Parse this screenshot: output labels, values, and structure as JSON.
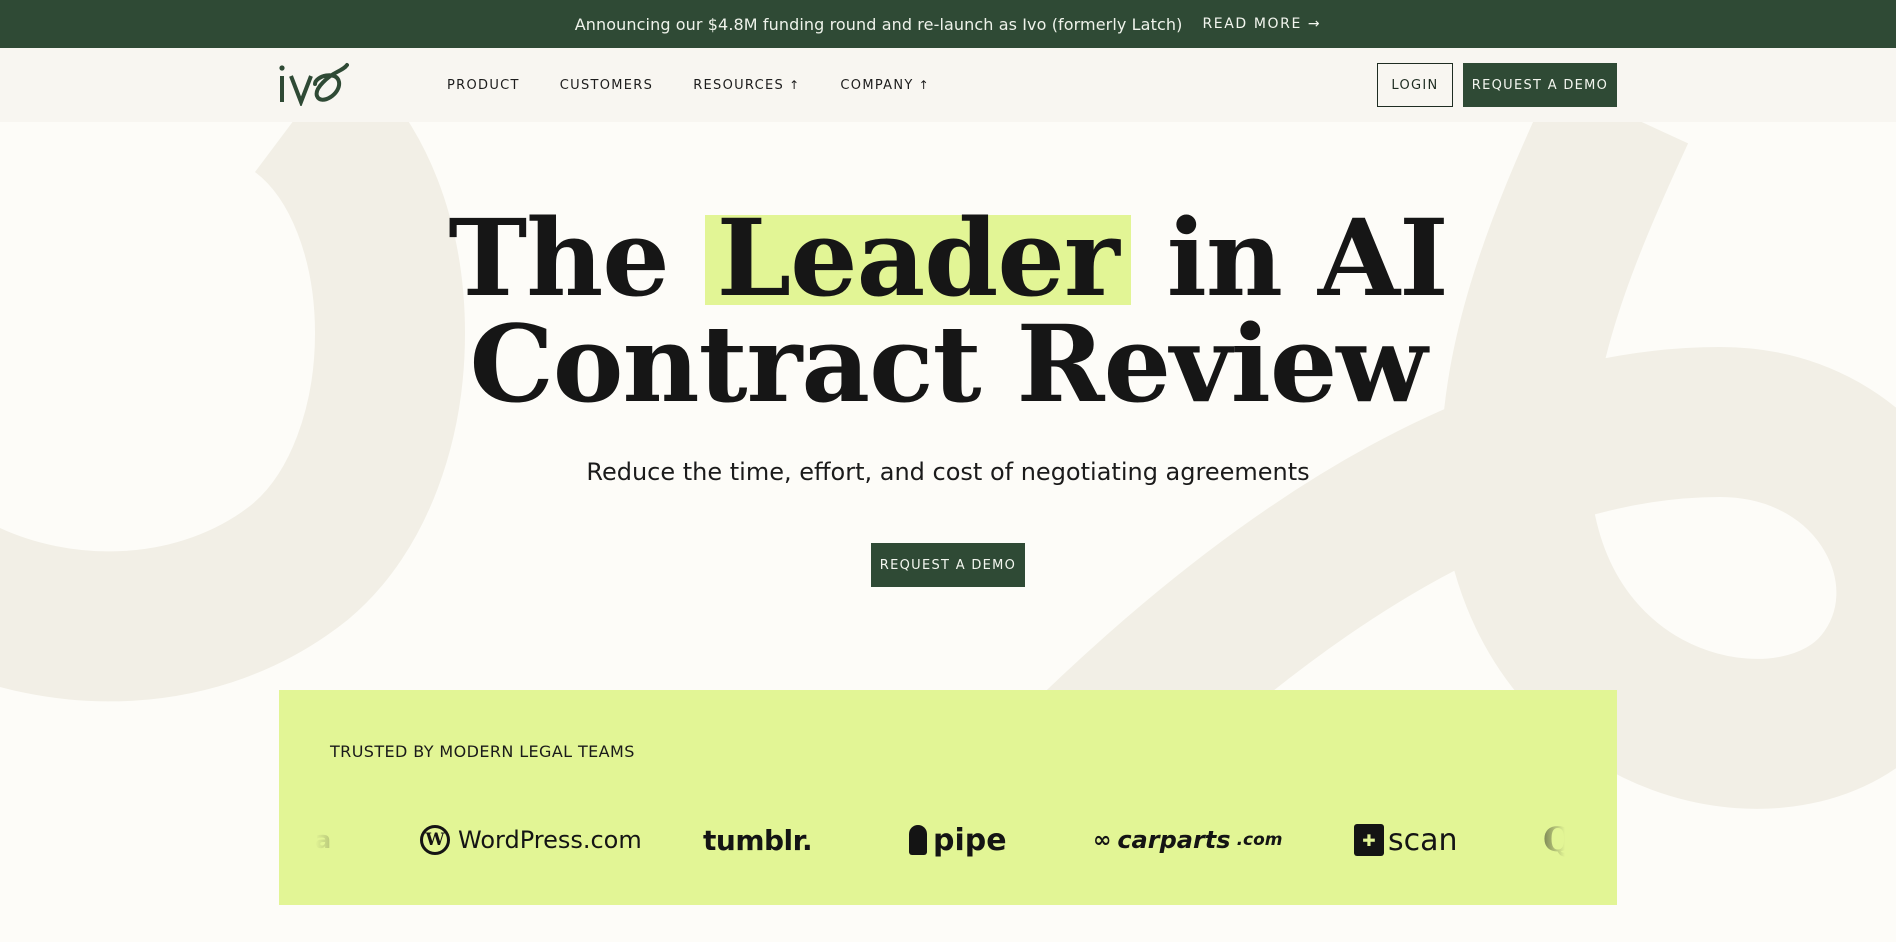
{
  "announcement": {
    "text": "Announcing our $4.8M funding round and re-launch as Ivo (formerly Latch)",
    "link_label": "READ MORE",
    "link_arrow": "→"
  },
  "nav": {
    "logo_text": "ivo",
    "items": [
      {
        "label": "PRODUCT",
        "arrow": ""
      },
      {
        "label": "CUSTOMERS",
        "arrow": ""
      },
      {
        "label": "RESOURCES",
        "arrow": "↑"
      },
      {
        "label": "COMPANY",
        "arrow": "↑"
      }
    ],
    "login_label": "LOGIN",
    "demo_label": "REQUEST A DEMO"
  },
  "hero": {
    "title_prefix": "The",
    "title_highlight": "Leader",
    "title_suffix": "in AI",
    "title_line2": "Contract Review",
    "subtitle": "Reduce the time, effort, and cost of negotiating agreements",
    "cta_label": "REQUEST A DEMO"
  },
  "trusted": {
    "label": "TRUSTED BY MODERN LEGAL TEAMS",
    "logos": {
      "partial_left": "a",
      "wordpress": "WordPress.com",
      "wordpress_mark": "W",
      "tumblr": "tumblr.",
      "pipe": "pipe",
      "carparts": "carparts",
      "carparts_suffix": ".com",
      "scan": "scan",
      "partial_right": "Q"
    }
  },
  "colors": {
    "brand_green": "#2f4a35",
    "highlight_lime": "#e2f595",
    "page_bg": "#fdfcf8",
    "nav_bg": "#f8f6f1"
  },
  "icons": [
    "arrow-right-icon",
    "chevron-up-icon",
    "wordpress-logo-icon",
    "pipe-logo-icon",
    "carparts-logo-icon",
    "scan-logo-icon"
  ]
}
